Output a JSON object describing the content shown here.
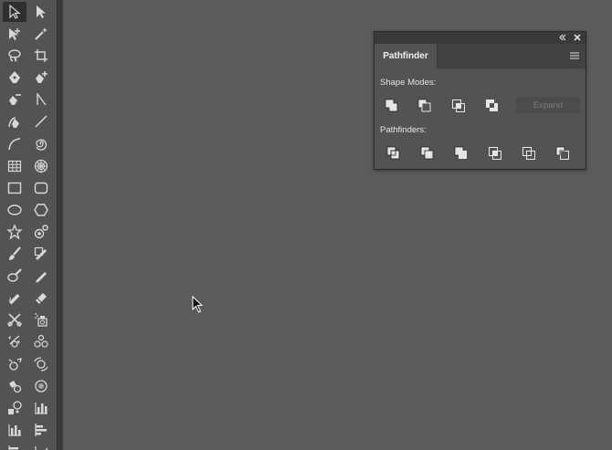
{
  "tools_panel": {
    "tools": [
      {
        "name": "selection-tool-icon",
        "active": true
      },
      {
        "name": "direct-selection-tool-icon"
      },
      {
        "name": "group-selection-tool-icon"
      },
      {
        "name": "magic-wand-tool-icon"
      },
      {
        "name": "lasso-tool-icon"
      },
      {
        "name": "artboard-tool-icon"
      },
      {
        "name": "pen-tool-icon"
      },
      {
        "name": "add-anchor-point-tool-icon"
      },
      {
        "name": "delete-anchor-point-tool-icon"
      },
      {
        "name": "anchor-point-tool-icon"
      },
      {
        "name": "curvature-tool-icon"
      },
      {
        "name": "line-segment-tool-icon"
      },
      {
        "name": "arc-tool-icon"
      },
      {
        "name": "spiral-tool-icon"
      },
      {
        "name": "rectangular-grid-tool-icon"
      },
      {
        "name": "polar-grid-tool-icon"
      },
      {
        "name": "rectangle-tool-icon"
      },
      {
        "name": "rounded-rectangle-tool-icon"
      },
      {
        "name": "ellipse-tool-icon"
      },
      {
        "name": "polygon-tool-icon"
      },
      {
        "name": "star-tool-icon"
      },
      {
        "name": "flare-tool-icon"
      },
      {
        "name": "paintbrush-tool-icon"
      },
      {
        "name": "shaper-tool-icon"
      },
      {
        "name": "blob-brush-tool-icon"
      },
      {
        "name": "pencil-tool-icon"
      },
      {
        "name": "smooth-tool-icon"
      },
      {
        "name": "eraser-tool-icon"
      },
      {
        "name": "scissors-tool-icon"
      },
      {
        "name": "symbol-sprayer-tool-icon"
      },
      {
        "name": "rotate-tool-icon"
      },
      {
        "name": "symbol-shifter-tool-icon"
      },
      {
        "name": "symbol-scruncher-tool-icon"
      },
      {
        "name": "symbol-spinner-tool-icon"
      },
      {
        "name": "symbol-stainer-tool-icon"
      },
      {
        "name": "symbol-screener-tool-icon"
      },
      {
        "name": "symbol-styler-tool-icon"
      },
      {
        "name": "column-graph-tool-icon"
      },
      {
        "name": "stacked-column-graph-tool-icon"
      },
      {
        "name": "bar-graph-tool-icon"
      },
      {
        "name": "stacked-bar-graph-tool-icon"
      },
      {
        "name": "line-graph-tool-icon"
      }
    ]
  },
  "pathfinder_panel": {
    "tab_label": "Pathfinder",
    "shape_modes_label": "Shape Modes:",
    "pathfinders_label": "Pathfinders:",
    "expand_label": "Expand",
    "shape_modes": [
      "unite-icon",
      "minus-front-icon",
      "intersect-icon",
      "exclude-icon"
    ],
    "pathfinders": [
      "divide-icon",
      "trim-icon",
      "merge-icon",
      "crop-icon",
      "outline-icon",
      "minus-back-icon"
    ]
  },
  "colors": {
    "canvas": "#5b5b5b",
    "panel": "#535353",
    "panel_dark": "#3a3a3a",
    "icon": "#e0e0e0"
  }
}
